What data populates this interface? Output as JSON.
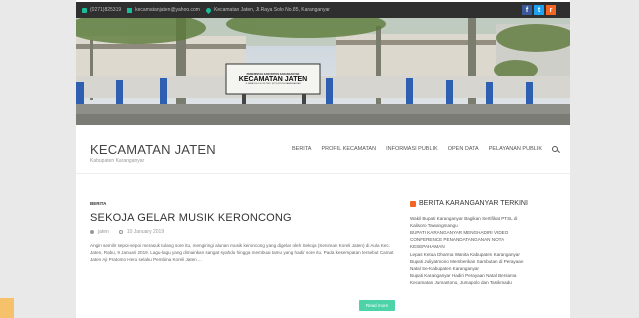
{
  "topbar": {
    "phone": "(0271)825319",
    "email": "kecamatanjaten@yahoo.com",
    "address": "Kecamatan Jaten, Jl.Raya Solo No.85, Karanganyar"
  },
  "social": {
    "fb": "f",
    "tw": "t",
    "rss": "r"
  },
  "hero": {
    "sign_line1": "PEMERINTAH KABUPATEN KARANGANYAR",
    "sign_line2": "KECAMATAN JATEN",
    "sign_line3": "Jl. RAYA SOLO NO.85 TELP. (0271) 825319 KARANGANYAR"
  },
  "brand": {
    "title": "KECAMATAN JATEN",
    "subtitle": "Kabupaten Karanganyar"
  },
  "nav": {
    "items": [
      "BERITA",
      "PROFIL KECAMATAN",
      "INFORMASI PUBLIK",
      "OPEN DATA",
      "PELAYANAN PUBLIK"
    ]
  },
  "post": {
    "category": "BERITA",
    "title": "SEKOJA GELAR MUSIK KERONCONG",
    "author": "jaten",
    "date": "10 January 2019",
    "excerpt": "Angin semilir sepoi-sepoi merasuk tulang sore itu, mengiringi alunan musik keroncong yang digelar oleh Sekoja (Seniman Koreli Jaten) di Aula Kec. Jaten, Rabu, 9 Januari 2019. Lagu-lagu yang dimainkan sangat syahdu hingga membuai tamu yang hadir sore itu. Pada kesempatan tersebut Camat Jaten Aji Pratomo Heru selaku Pembina Koreli Jaten ...",
    "read_more": "Read more"
  },
  "sidebar": {
    "title": "BERITA KARANGANYAR TERKINI",
    "items": [
      "Wakil Bupati Karanganyar Bagikan Sertifikat PTSL di",
      "Kalisoro Tawangmangu",
      "BUPATI KARANGANYAR MENGHADIRI VIDEO",
      "CONFERENCE PENANDATANGANAN NOTA",
      "KESEPAHAMAN",
      "Lepas Ketua Dharma Wanita Kabupaten Karanganyar",
      "Bupati Juliyatmono Memberikan Sambutan di Perayaan",
      "Natal Se-Kabupaten Karanganyar",
      "Bupati Karanganyar Hadiri Perayaan Natal Bersama",
      "Kecamatan Jumantono, Jumapolo dan Tasikmadu"
    ]
  }
}
